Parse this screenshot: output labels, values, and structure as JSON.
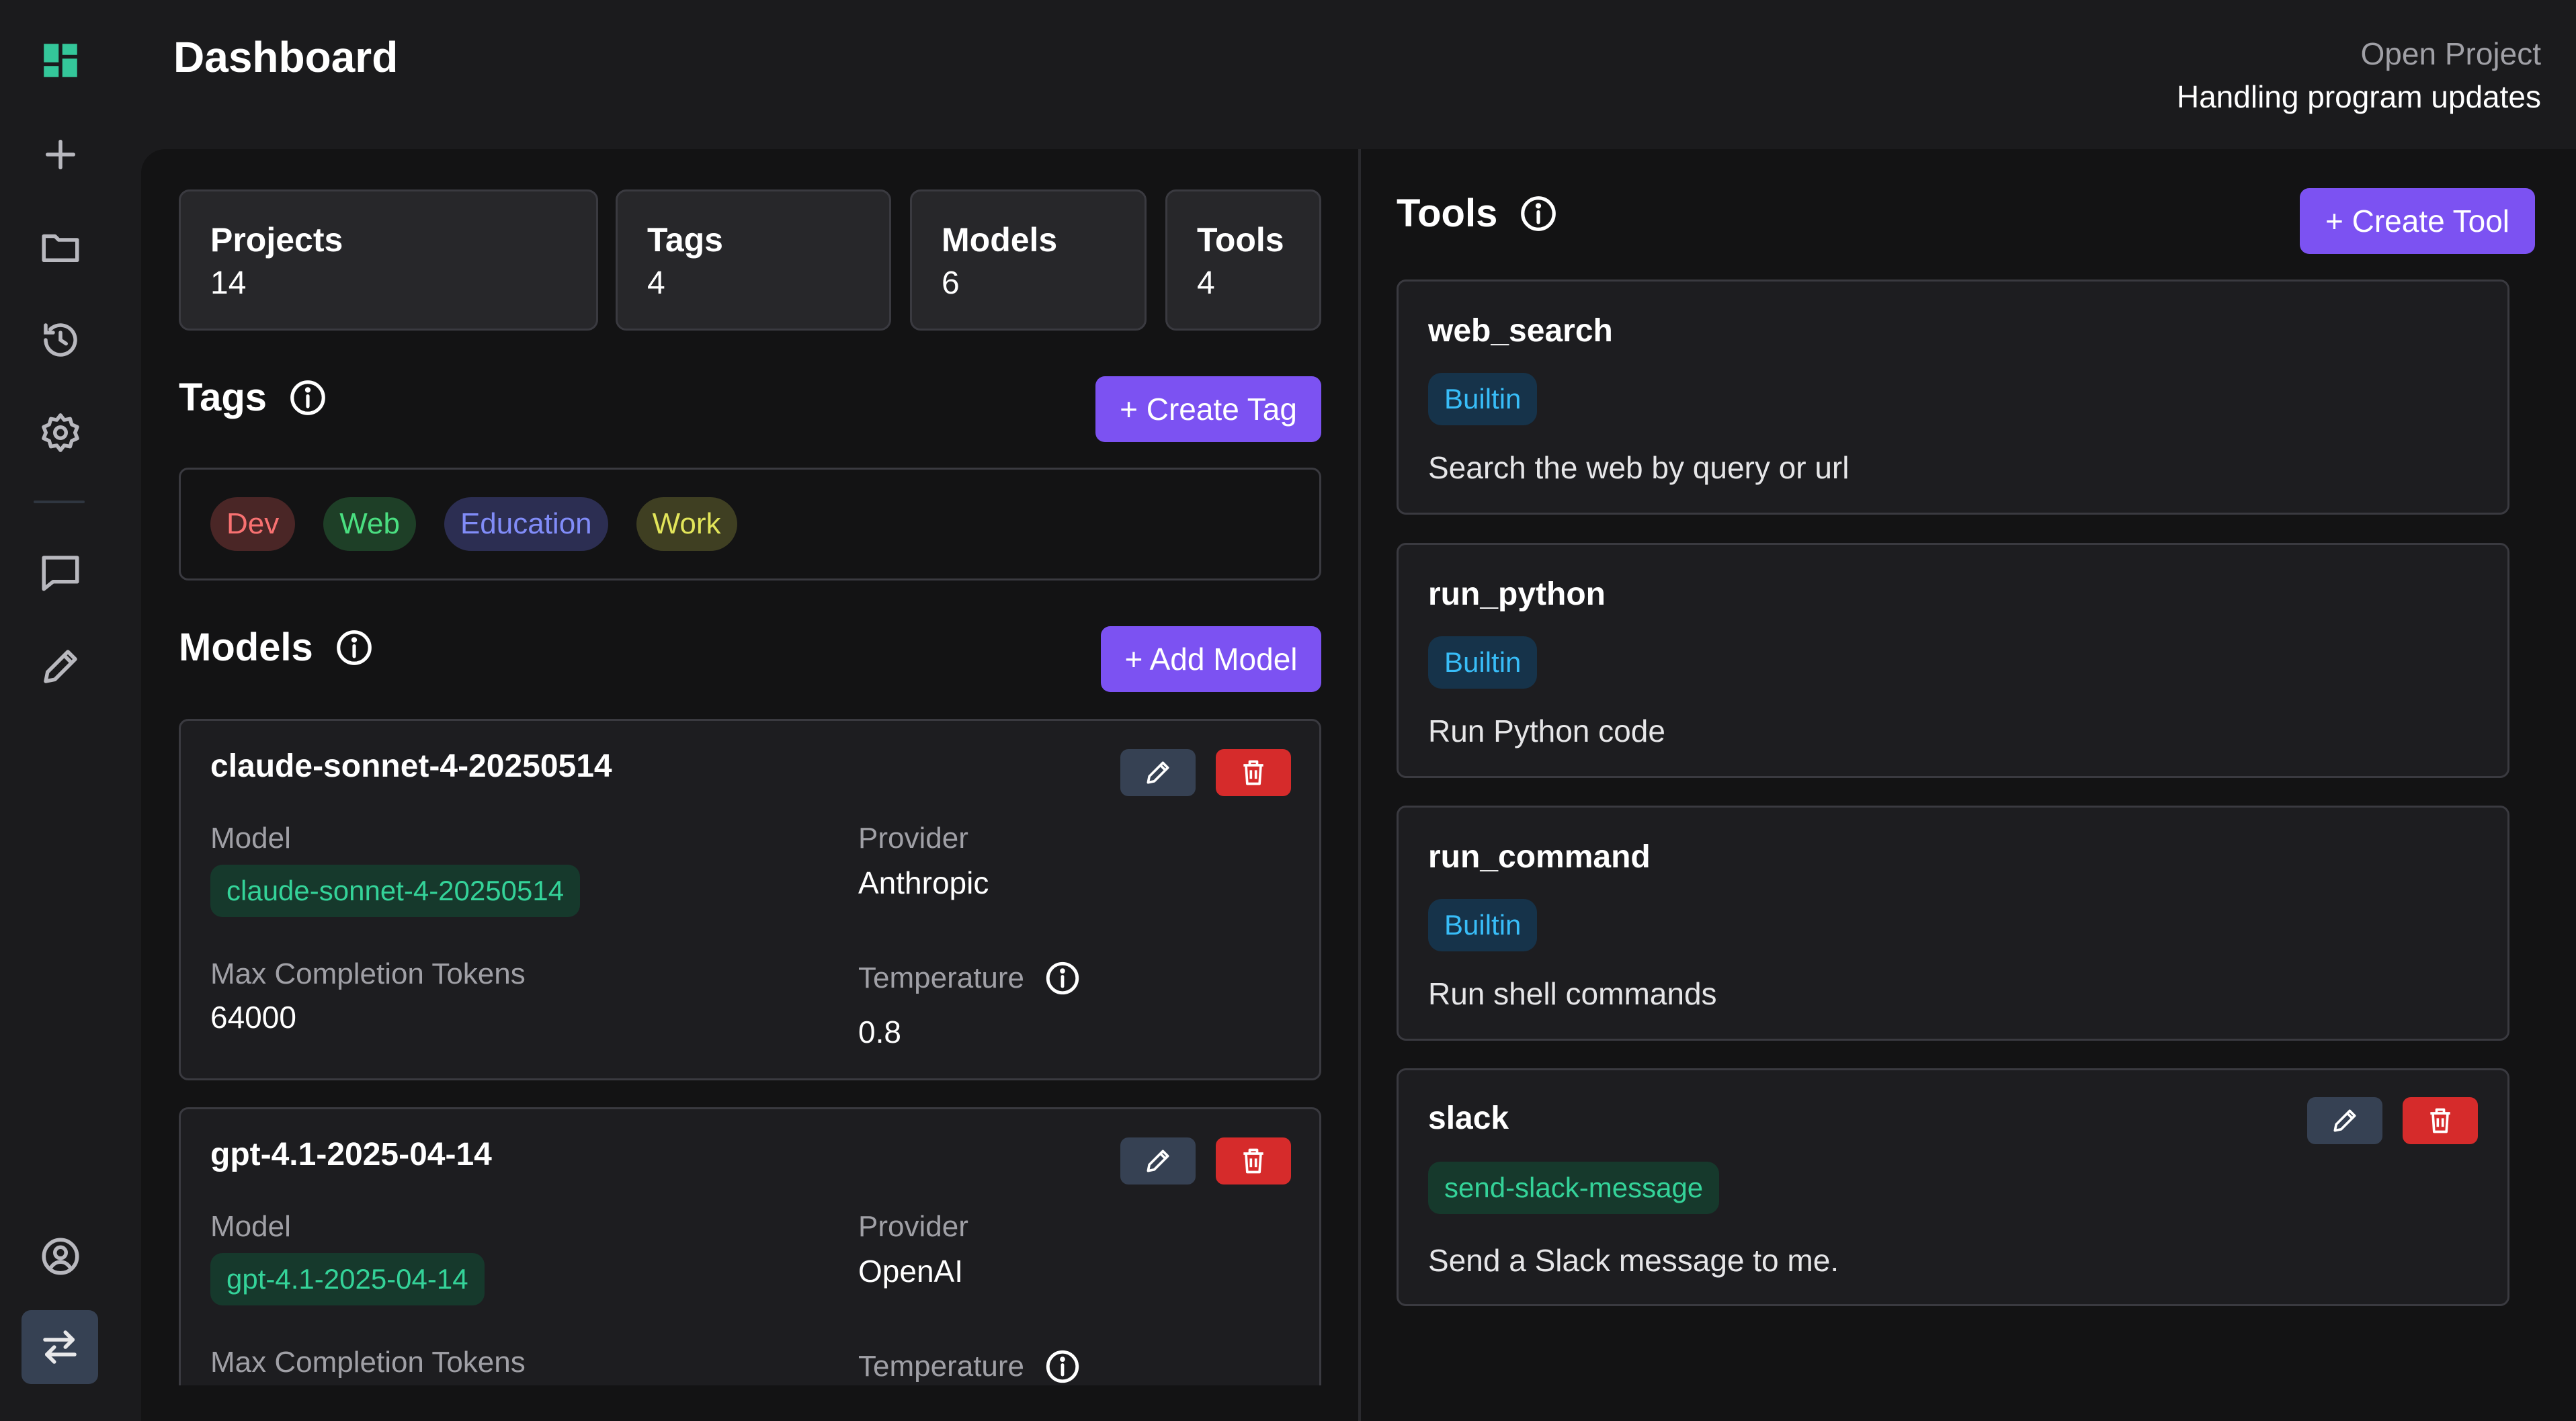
{
  "colors": {
    "accent": "#7c52f2",
    "brand_green": "#34d399",
    "delete_red": "#d62b2b",
    "builtin_blue": "#38bdf8"
  },
  "sidebar": {
    "items": [
      {
        "icon": "dashboard-icon"
      },
      {
        "icon": "plus-icon"
      },
      {
        "icon": "folder-icon"
      },
      {
        "icon": "history-icon"
      },
      {
        "icon": "gear-icon"
      },
      {
        "icon": "chat-icon"
      },
      {
        "icon": "pencil-icon"
      },
      {
        "icon": "user-circle-icon"
      },
      {
        "icon": "swap-arrows-icon"
      }
    ]
  },
  "header": {
    "title": "Dashboard",
    "project_label": "Open Project",
    "project_name": "Handling program updates"
  },
  "stats": [
    {
      "label": "Projects",
      "value": "14"
    },
    {
      "label": "Tags",
      "value": "4"
    },
    {
      "label": "Models",
      "value": "6"
    },
    {
      "label": "Tools",
      "value": "4"
    }
  ],
  "tags_section": {
    "title": "Tags",
    "create_label": "+ Create Tag",
    "tags": [
      {
        "label": "Dev",
        "color": "#f87171",
        "bg": "#4a2626"
      },
      {
        "label": "Web",
        "color": "#4ade80",
        "bg": "#1e3f27"
      },
      {
        "label": "Education",
        "color": "#818cf8",
        "bg": "#2c2e52"
      },
      {
        "label": "Work",
        "color": "#e2e55a",
        "bg": "#3f3f22"
      }
    ]
  },
  "models_section": {
    "title": "Models",
    "add_label": "+ Add Model",
    "field_labels": {
      "model": "Model",
      "provider": "Provider",
      "max_tokens": "Max Completion Tokens",
      "temperature": "Temperature"
    },
    "models": [
      {
        "name": "claude-sonnet-4-20250514",
        "model": "claude-sonnet-4-20250514",
        "provider": "Anthropic",
        "max_tokens": "64000",
        "temperature": "0.8"
      },
      {
        "name": "gpt-4.1-2025-04-14",
        "model": "gpt-4.1-2025-04-14",
        "provider": "OpenAI"
      }
    ]
  },
  "tools_section": {
    "title": "Tools",
    "create_label": "+ Create Tool",
    "tools": [
      {
        "name": "web_search",
        "badge": "Builtin",
        "description": "Search the web by query or url"
      },
      {
        "name": "run_python",
        "badge": "Builtin",
        "description": "Run Python code"
      },
      {
        "name": "run_command",
        "badge": "Builtin",
        "description": "Run shell commands"
      },
      {
        "name": "slack",
        "badge": "send-slack-message",
        "description": "Send a Slack message to me."
      }
    ]
  }
}
